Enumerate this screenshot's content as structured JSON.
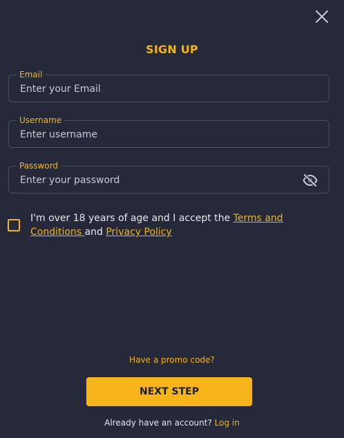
{
  "modal": {
    "title": "SIGN UP"
  },
  "fields": {
    "email": {
      "label": "Email",
      "placeholder": "Enter your Email"
    },
    "username": {
      "label": "Username",
      "placeholder": "Enter username"
    },
    "password": {
      "label": "Password",
      "placeholder": "Enter your password"
    }
  },
  "consent": {
    "prefix": "I'm over 18 years of age and I accept the ",
    "terms_link": "Terms and Conditions ",
    "middle": "and ",
    "privacy_link": "Privacy Policy"
  },
  "promo": {
    "label": "Have a promo code?"
  },
  "next_button": {
    "label": "NEXT STEP"
  },
  "login": {
    "prefix": "Already have an account? ",
    "link": "Log in"
  },
  "icons": {
    "close": "close-icon",
    "password_toggle": "eye-slash-icon"
  },
  "colors": {
    "accent": "#f3b51b",
    "background": "#262939",
    "button": "#f6b51a"
  }
}
